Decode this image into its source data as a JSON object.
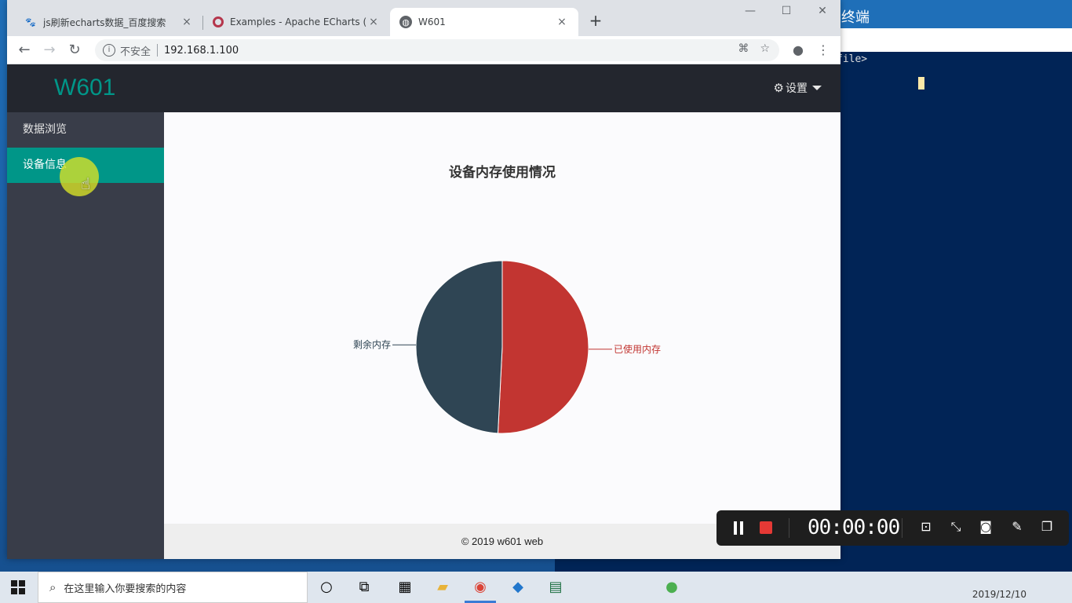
{
  "terminal": {
    "title": "终端",
    "prompt_fragment": "file>"
  },
  "browser": {
    "tabs": [
      {
        "title": "js刷新echarts数据_百度搜索",
        "icon": "baidu-paw-icon",
        "close": "×"
      },
      {
        "title": "Examples - Apache ECharts (in",
        "icon": "echarts-icon",
        "close": "×"
      },
      {
        "title": "W601",
        "icon": "globe-icon",
        "close": "×"
      }
    ],
    "new_tab": "+",
    "window_controls": {
      "minimize": "—",
      "maximize": "☐",
      "close": "✕"
    },
    "nav": {
      "back": "←",
      "forward": "→",
      "reload": "↻"
    },
    "omnibox": {
      "info": "i",
      "security": "不安全",
      "url": "192.168.1.100"
    }
  },
  "app": {
    "logo": "W601",
    "settings_label": "设置",
    "sidebar": {
      "items": [
        {
          "label": "数据浏览",
          "active": false
        },
        {
          "label": "设备信息",
          "active": true
        }
      ]
    },
    "footer": "© 2019 w601 web"
  },
  "chart_data": {
    "type": "pie",
    "title": "设备内存使用情况",
    "series": [
      {
        "name": "已使用内存",
        "value": 50.8,
        "color": "#c23531"
      },
      {
        "name": "剩余内存",
        "value": 49.2,
        "color": "#2f4554"
      }
    ]
  },
  "recorder": {
    "time": "00:00:00"
  },
  "taskbar": {
    "search_placeholder": "在这里输入你要搜索的内容",
    "date": "2019/12/10"
  }
}
